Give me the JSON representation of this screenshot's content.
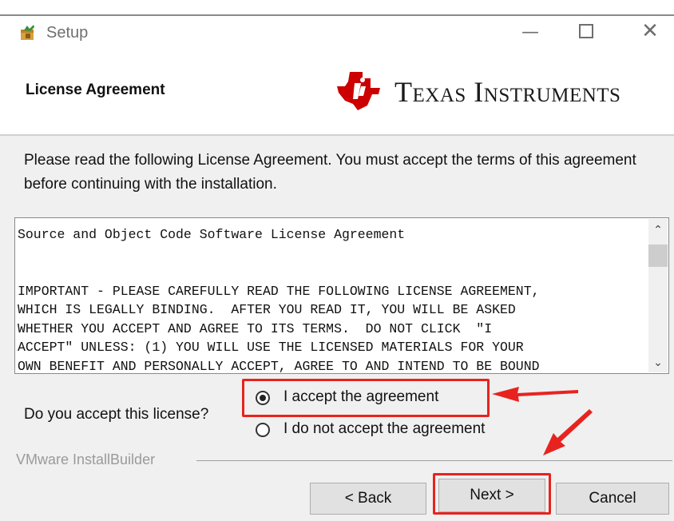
{
  "window": {
    "title": "Setup",
    "minimize_glyph": "—",
    "close_glyph": "✕"
  },
  "header": {
    "title": "License Agreement",
    "brand": "Texas Instruments"
  },
  "intro_text": "Please read the following License Agreement. You must accept the terms of this agreement before continuing with the installation.",
  "license": {
    "text": "Source and Object Code Software License Agreement\n\n\nIMPORTANT - PLEASE CAREFULLY READ THE FOLLOWING LICENSE AGREEMENT,\nWHICH IS LEGALLY BINDING.  AFTER YOU READ IT, YOU WILL BE ASKED\nWHETHER YOU ACCEPT AND AGREE TO ITS TERMS.  DO NOT CLICK  \"I\nACCEPT\" UNLESS: (1) YOU WILL USE THE LICENSED MATERIALS FOR YOUR\nOWN BENEFIT AND PERSONALLY ACCEPT, AGREE TO AND INTEND TO BE BOUND",
    "scroll_up_glyph": "⌃",
    "scroll_down_glyph": "⌄"
  },
  "question": "Do you accept this license?",
  "options": [
    {
      "label": "I accept the agreement",
      "selected": true
    },
    {
      "label": "I do not accept the agreement",
      "selected": false
    }
  ],
  "builder": "VMware InstallBuilder",
  "buttons": {
    "back": "< Back",
    "next": "Next >",
    "cancel": "Cancel"
  },
  "colors": {
    "annotation": "#e8231f",
    "ti_red": "#cc0000"
  },
  "icons": [
    "app-icon",
    "ti-logo-icon",
    "minimize-icon",
    "maximize-icon",
    "close-icon",
    "scroll-up-icon",
    "scroll-down-icon",
    "annotation-arrow-icon"
  ]
}
